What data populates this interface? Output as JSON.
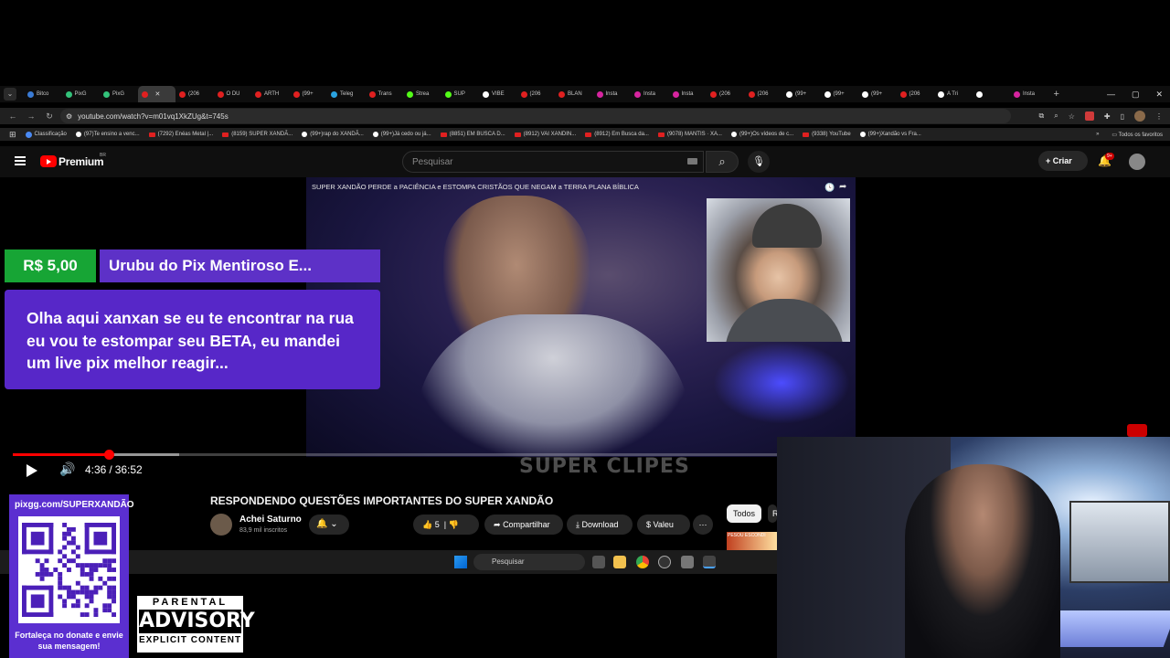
{
  "browser": {
    "tabs": [
      {
        "label": "Bitco",
        "color": "#3a7bd5"
      },
      {
        "label": "PixG",
        "color": "#33c27a"
      },
      {
        "label": "PixG",
        "color": "#33c27a"
      },
      {
        "label": "",
        "color": "#e02020",
        "active": true
      },
      {
        "label": "(206",
        "color": "#e02020"
      },
      {
        "label": "O DU",
        "color": "#e02020"
      },
      {
        "label": "ARTH",
        "color": "#e02020"
      },
      {
        "label": "(99+",
        "color": "#e02020"
      },
      {
        "label": "Teleg",
        "color": "#2aa3e0"
      },
      {
        "label": "Trans",
        "color": "#e02020"
      },
      {
        "label": "Strea",
        "color": "#53fc18"
      },
      {
        "label": "SUP",
        "color": "#53fc18"
      },
      {
        "label": "VIBE",
        "color": "#ffffff"
      },
      {
        "label": "(206",
        "color": "#e02020"
      },
      {
        "label": "BLAN",
        "color": "#e02020"
      },
      {
        "label": "Insta",
        "color": "#d6249f"
      },
      {
        "label": "Insta",
        "color": "#d6249f"
      },
      {
        "label": "Insta",
        "color": "#d6249f"
      },
      {
        "label": "(206",
        "color": "#e02020"
      },
      {
        "label": "(206",
        "color": "#e02020"
      },
      {
        "label": "(99+",
        "color": "#ffffff"
      },
      {
        "label": "(99+",
        "color": "#ffffff"
      },
      {
        "label": "(99+",
        "color": "#ffffff"
      },
      {
        "label": "(206",
        "color": "#e02020"
      },
      {
        "label": "A Tri",
        "color": "#ffffff"
      },
      {
        "label": "",
        "color": "#ffffff"
      },
      {
        "label": "Insta",
        "color": "#d6249f"
      }
    ],
    "url": "youtube.com/watch?v=m01vq1XkZUg&t=745s",
    "bookmarks": [
      {
        "label": "Classificação",
        "kind": "g"
      },
      {
        "label": "(97)Te ensino a venc...",
        "kind": "tt"
      },
      {
        "label": "(7292) Enéas Metal |...",
        "kind": "yt"
      },
      {
        "label": "(8159) SUPER XANDÃ...",
        "kind": "yt"
      },
      {
        "label": "(99+)rap do XANDÃ...",
        "kind": "tt"
      },
      {
        "label": "(99+)Já cedo ou já...",
        "kind": "tt"
      },
      {
        "label": "(8851) EM BUSCA D...",
        "kind": "yt"
      },
      {
        "label": "(8912) VAI XANDIN...",
        "kind": "yt"
      },
      {
        "label": "(8912) Em Busca da...",
        "kind": "yt"
      },
      {
        "label": "(9078) MANTIS · XA...",
        "kind": "yt"
      },
      {
        "label": "(99+)Os vídeos de c...",
        "kind": "tt"
      },
      {
        "label": "(9338) YouTube",
        "kind": "yt"
      },
      {
        "label": "(99+)Xandão vs Fra...",
        "kind": "tt"
      }
    ],
    "all_bookmarks_label": "Todos os favoritos"
  },
  "youtube": {
    "brand": "Premium",
    "country": "BR",
    "search_placeholder": "Pesquisar",
    "create_label": "Criar",
    "notif_badge": "9+"
  },
  "player": {
    "overlay_title": "SUPER XANDÃO PERDE a PACIÊNCIA e ESTOMPA CRISTÃOS QUE NEGAM a TERRA PLANA BÍBLICA",
    "watermark": "SUPER CLIPES",
    "current_time": "4:36",
    "separator": "/",
    "duration": "36:52",
    "progress_fraction": 0.125,
    "buffered_fraction": 0.218,
    "livepix": {
      "amount": "R$ 5,00",
      "name": "Urubu do Pix Mentiroso E...",
      "message": "Olha aqui xanxan se eu te encontrar na rua eu vou te estompar seu BETA, eu mandei um live pix melhor reagir..."
    }
  },
  "video": {
    "title": "RESPONDENDO QUESTÕES IMPORTANTES DO SUPER XANDÃO",
    "channel": "Achei Saturno",
    "subscribers": "83,9 mil inscritos",
    "likes": "5",
    "share_label": "Compartilhar",
    "download_label": "Download",
    "thanks_label": "Valeu",
    "chip_all": "Todos",
    "chip_partial": "R",
    "side_thumb_text": "PESOU ESCONDI"
  },
  "taskbar": {
    "search_label": "Pesquisar"
  },
  "overlays": {
    "pix_link": "pixgg.com/SUPERXANDÃO",
    "pix_cta": "Fortaleça no donate e envie sua mensagem!",
    "advisory_top": "PARENTAL",
    "advisory_mid": "ADVISORY",
    "advisory_bottom": "EXPLICIT CONTENT"
  },
  "colors": {
    "yt_red": "#ff0000",
    "pix_green": "#17a535",
    "pix_purple": "#5727c8"
  }
}
